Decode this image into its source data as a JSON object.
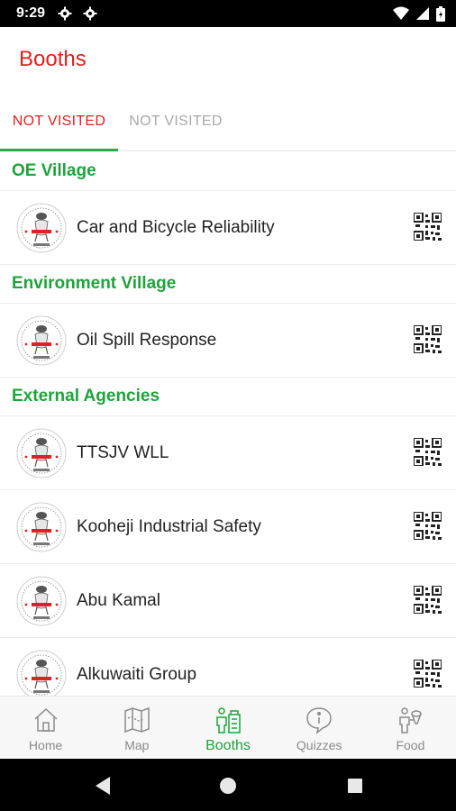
{
  "status_bar": {
    "time": "9:29"
  },
  "app_bar": {
    "title": "Booths"
  },
  "tabs": [
    {
      "label": "NOT VISITED",
      "active": true
    },
    {
      "label": "NOT VISITED",
      "active": false
    }
  ],
  "sections": [
    {
      "header": "OE Village",
      "items": [
        {
          "name": "Car and Bicycle Reliability"
        }
      ]
    },
    {
      "header": "Environment Village",
      "items": [
        {
          "name": "Oil Spill Response"
        }
      ]
    },
    {
      "header": "External Agencies",
      "items": [
        {
          "name": "TTSJV WLL"
        },
        {
          "name": "Kooheji Industrial Safety"
        },
        {
          "name": "Abu Kamal"
        },
        {
          "name": "Alkuwaiti Group"
        }
      ]
    }
  ],
  "bottom_nav": [
    {
      "label": "Home",
      "icon": "home-icon",
      "active": false
    },
    {
      "label": "Map",
      "icon": "map-icon",
      "active": false
    },
    {
      "label": "Booths",
      "icon": "booths-icon",
      "active": true
    },
    {
      "label": "Quizzes",
      "icon": "quizzes-icon",
      "active": false
    },
    {
      "label": "Food",
      "icon": "food-icon",
      "active": false
    }
  ],
  "colors": {
    "accent_red": "#e0211f",
    "accent_green": "#1fa33c"
  }
}
